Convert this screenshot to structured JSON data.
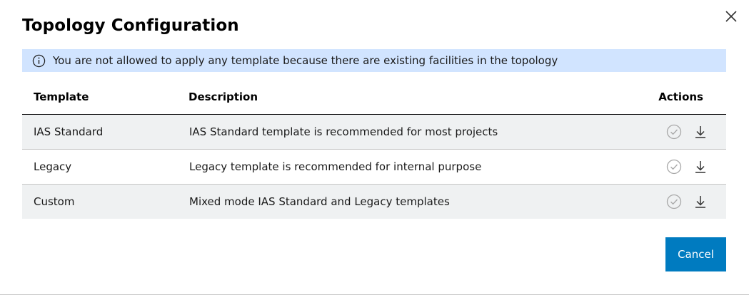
{
  "dialog": {
    "title": "Topology Configuration",
    "banner": {
      "icon": "info-icon",
      "text": "You are not allowed to apply any template because there are existing facilities in the topology",
      "background": "#d1e4ff"
    },
    "table": {
      "headers": {
        "template": "Template",
        "description": "Description",
        "actions": "Actions"
      },
      "rows": [
        {
          "template": "IAS Standard",
          "description": "IAS Standard template is recommended for most projects"
        },
        {
          "template": "Legacy",
          "description": "Legacy template is recommended for internal purpose"
        },
        {
          "template": "Custom",
          "description": "Mixed mode IAS Standard and Legacy templates"
        }
      ],
      "row_icons": [
        "check-circle-icon",
        "download-icon"
      ]
    },
    "cancel_label": "Cancel",
    "accent_color": "#007bc0"
  }
}
